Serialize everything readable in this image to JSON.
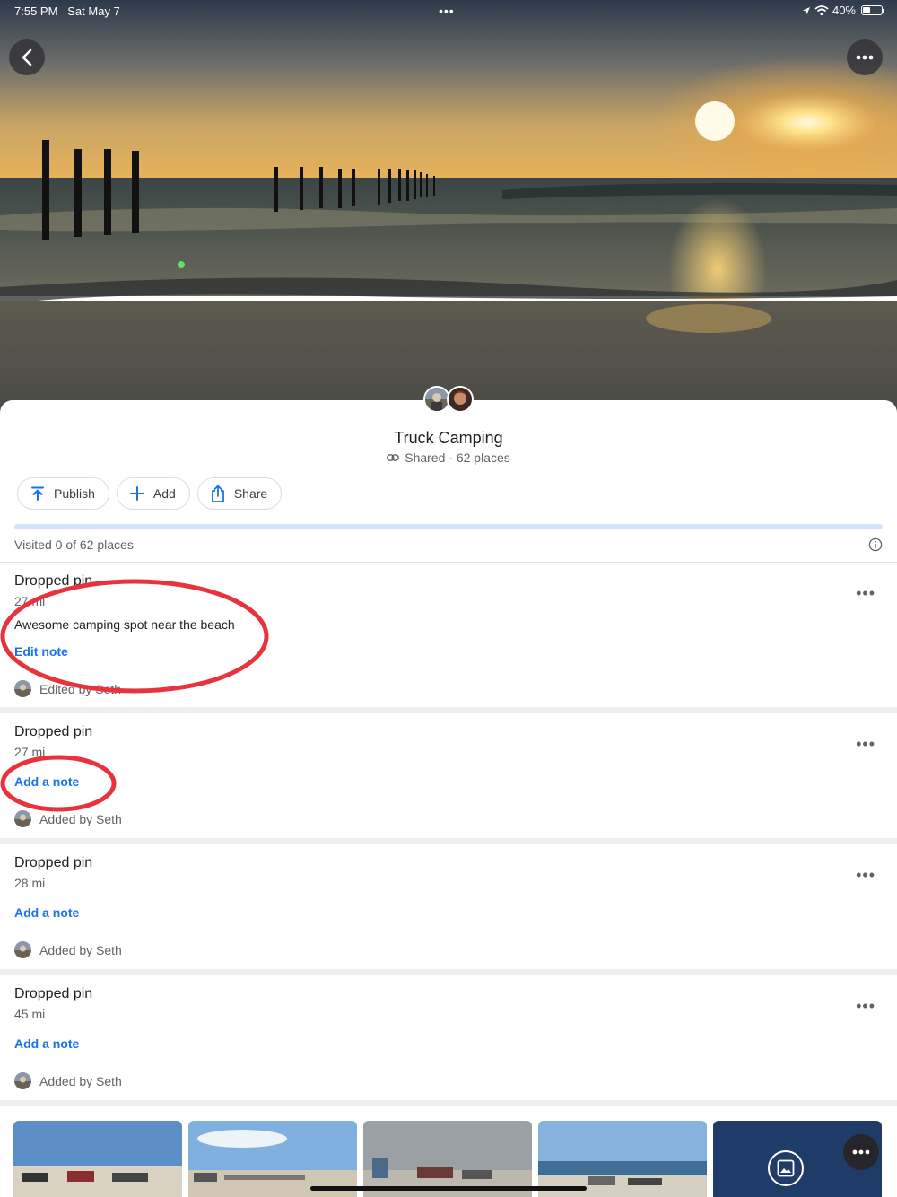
{
  "status_bar": {
    "time": "7:55 PM",
    "date": "Sat May 7",
    "battery": "40%",
    "battery_level": 0.4
  },
  "hero": {
    "back_icon": "chevron-left-icon",
    "more_icon": "more-horizontal-icon"
  },
  "list": {
    "title": "Truck Camping",
    "meta": "Shared · 62 places",
    "meta_icon": "link-icon",
    "visited_text": "Visited 0 of 62 places",
    "progress_fraction": 0.0
  },
  "actions": [
    {
      "label": "Publish",
      "icon": "publish-icon"
    },
    {
      "label": "Add",
      "icon": "plus-icon"
    },
    {
      "label": "Share",
      "icon": "share-icon"
    }
  ],
  "places": [
    {
      "name": "Dropped pin",
      "distance": "27 mi",
      "note": "Awesome camping spot near the beach",
      "link": "Edit note",
      "attribution": "Edited by Seth"
    },
    {
      "name": "Dropped pin",
      "distance": "27 mi",
      "link": "Add a note",
      "attribution": "Added by Seth"
    },
    {
      "name": "Dropped pin",
      "distance": "28 mi",
      "link": "Add a note",
      "attribution": "Added by Seth"
    },
    {
      "name": "Dropped pin",
      "distance": "45 mi",
      "link": "Add a note",
      "attribution": "Added by Seth"
    }
  ],
  "colors": {
    "accent": "#1a73e8",
    "annotation": "#e8323c",
    "progress_track": "#d2e3fc"
  }
}
